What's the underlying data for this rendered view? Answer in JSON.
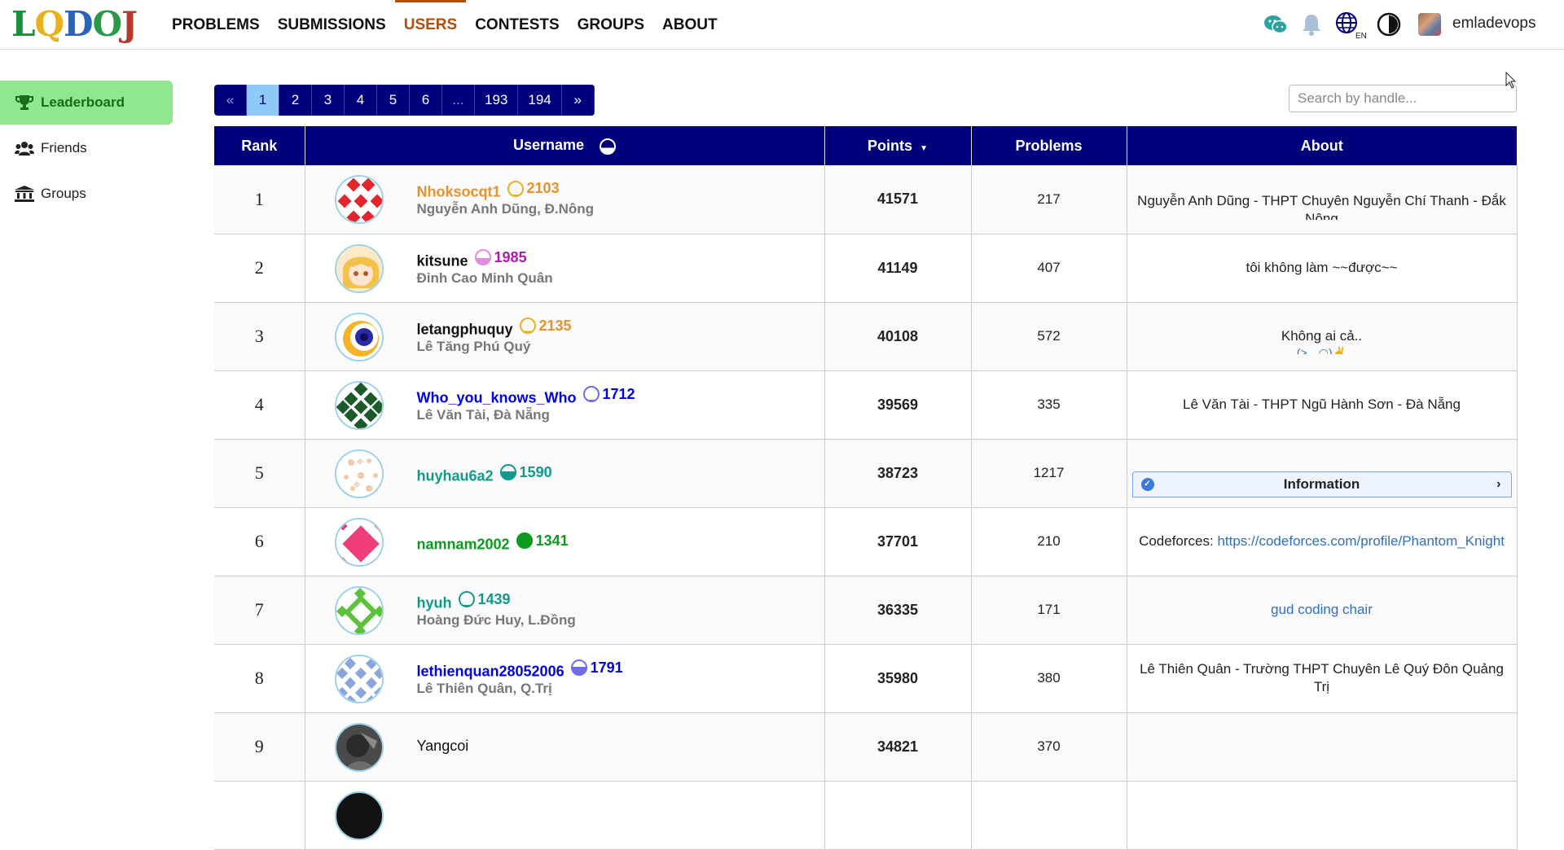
{
  "header": {
    "logo_letters": [
      "L",
      "Q",
      "D",
      "O",
      "J"
    ],
    "nav": [
      "PROBLEMS",
      "SUBMISSIONS",
      "USERS",
      "CONTESTS",
      "GROUPS",
      "ABOUT"
    ],
    "active_nav": "USERS",
    "lang_badge": "EN",
    "username": "emladevops"
  },
  "sidebar": {
    "items": [
      {
        "label": "Leaderboard",
        "icon": "trophy-icon"
      },
      {
        "label": "Friends",
        "icon": "users-icon"
      },
      {
        "label": "Groups",
        "icon": "institution-icon"
      }
    ]
  },
  "pagination": {
    "prev": "«",
    "pages": [
      "1",
      "2",
      "3",
      "4",
      "5",
      "6",
      "...",
      "193",
      "194"
    ],
    "current": "1",
    "next": "»"
  },
  "search": {
    "placeholder": "Search by handle..."
  },
  "table": {
    "headers": {
      "rank": "Rank",
      "username": "Username",
      "points": "Points",
      "problems": "Problems",
      "about": "About"
    },
    "rows": [
      {
        "rank": "1",
        "username": "Nhoksocqt1",
        "rating": "2103",
        "fullname": "Nguyễn Anh Dũng, Đ.Nông",
        "points": "41571",
        "problems": "217",
        "about": "Nguyễn Anh Dũng - THPT Chuyên Nguyễn Chí Thanh - Đắk Nông",
        "color": "#e8912c"
      },
      {
        "rank": "2",
        "username": "kitsune",
        "rating": "1985",
        "fullname": "Đinh Cao Minh Quân",
        "points": "41149",
        "problems": "407",
        "about": "tôi không làm ~~được~~",
        "color": "#b316b3"
      },
      {
        "rank": "3",
        "username": "letangphuquy",
        "rating": "2135",
        "fullname": "Lê Tăng Phú Quý",
        "points": "40108",
        "problems": "572",
        "about": "Không ai cả..",
        "about2": "(>　◠)✌",
        "color": "#e8912c"
      },
      {
        "rank": "4",
        "username": "Who_you_knows_Who",
        "rating": "1712",
        "fullname": "Lê Văn Tài, Đà Nẵng",
        "points": "39569",
        "problems": "335",
        "about": "Lê Văn Tài - THPT Ngũ Hành Sơn - Đà Nẵng",
        "color": "#0000e6"
      },
      {
        "rank": "5",
        "username": "huyhau6a2",
        "rating": "1590",
        "fullname": "",
        "points": "38723",
        "problems": "1217",
        "about": "Information",
        "color": "#109a8c"
      },
      {
        "rank": "6",
        "username": "namnam2002",
        "rating": "1341",
        "fullname": "",
        "points": "37701",
        "problems": "210",
        "about": "Codeforces: ",
        "about_link": "https://codeforces.com/profile/Phantom_Knight",
        "color": "#0b9a1f"
      },
      {
        "rank": "7",
        "username": "hyuh",
        "rating": "1439",
        "fullname": "Hoàng Đức Huy, L.Đồng",
        "points": "36335",
        "problems": "171",
        "about_link": "gud coding chair",
        "color": "#109a8c"
      },
      {
        "rank": "8",
        "username": "lethienquan28052006",
        "rating": "1791",
        "fullname": "Lê Thiên Quân, Q.Trị",
        "points": "35980",
        "problems": "380",
        "about": "Lê Thiên Quân - Trường THPT Chuyên Lê Quý Đôn Quảng Trị",
        "color": "#0000e6"
      },
      {
        "rank": "9",
        "username": "Yangcoi",
        "rating": "",
        "fullname": "",
        "points": "34821",
        "problems": "370",
        "about": "",
        "color": "#111111"
      }
    ]
  }
}
